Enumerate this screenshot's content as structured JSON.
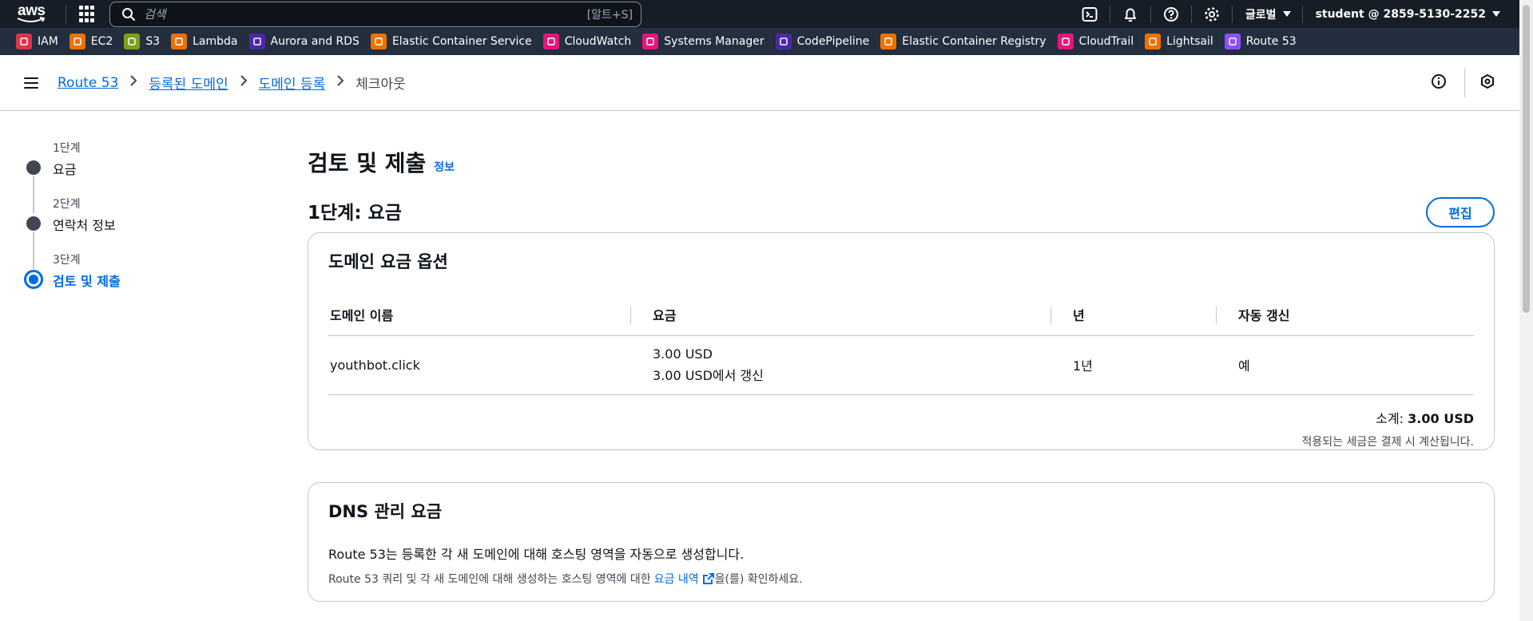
{
  "topnav": {
    "logo_text": "aws",
    "search_placeholder": "검색",
    "search_shortcut": "[알트+S]",
    "region": "글로벌",
    "account": "student @ 2859-5130-2252",
    "icons": [
      "cloudshell-icon",
      "bell-icon",
      "help-icon",
      "settings-icon"
    ]
  },
  "favorites": [
    {
      "label": "IAM",
      "color": "#dd344c",
      "icon": "iam-icon"
    },
    {
      "label": "EC2",
      "color": "#ed7100",
      "icon": "ec2-icon"
    },
    {
      "label": "S3",
      "color": "#7aa116",
      "icon": "s3-icon"
    },
    {
      "label": "Lambda",
      "color": "#ed7100",
      "icon": "lambda-icon"
    },
    {
      "label": "Aurora and RDS",
      "color": "#4d27aa",
      "icon": "rds-icon"
    },
    {
      "label": "Elastic Container Service",
      "color": "#ed7100",
      "icon": "ecs-icon"
    },
    {
      "label": "CloudWatch",
      "color": "#e7157b",
      "icon": "cloudwatch-icon"
    },
    {
      "label": "Systems Manager",
      "color": "#e7157b",
      "icon": "ssm-icon"
    },
    {
      "label": "CodePipeline",
      "color": "#4d27aa",
      "icon": "codepipeline-icon"
    },
    {
      "label": "Elastic Container Registry",
      "color": "#ed7100",
      "icon": "ecr-icon"
    },
    {
      "label": "CloudTrail",
      "color": "#e7157b",
      "icon": "cloudtrail-icon"
    },
    {
      "label": "Lightsail",
      "color": "#ed7100",
      "icon": "lightsail-icon"
    },
    {
      "label": "Route 53",
      "color": "#8c4fff",
      "icon": "route53-icon"
    }
  ],
  "breadcrumb": [
    {
      "label": "Route 53",
      "link": true
    },
    {
      "label": "등록된 도메인",
      "link": true
    },
    {
      "label": "도메인 등록",
      "link": true
    },
    {
      "label": "체크아웃",
      "link": false
    }
  ],
  "steps": [
    {
      "num": "1단계",
      "label": "요금",
      "active": false
    },
    {
      "num": "2단계",
      "label": "연락처 정보",
      "active": false
    },
    {
      "num": "3단계",
      "label": "검토 및 제출",
      "active": true
    }
  ],
  "main": {
    "title": "검토 및 제출",
    "info": "정보",
    "section1_title": "1단계: 요금",
    "edit_label": "편집",
    "card1": {
      "title": "도메인 요금 옵션",
      "columns": [
        "도메인 이름",
        "요금",
        "년",
        "자동 갱신"
      ],
      "row": {
        "domain": "youthbot.click",
        "price": "3.00 USD",
        "renew_price": "3.00 USD에서 갱신",
        "years": "1년",
        "auto_renew": "예"
      },
      "subtotal_label": "소계:",
      "subtotal_value": "3.00 USD",
      "tax_note": "적용되는 세금은 결제 시 계산됩니다."
    },
    "card2": {
      "title": "DNS 관리 요금",
      "desc": "Route 53는 등록한 각 새 도메인에 대해 호스팅 영역을 자동으로 생성합니다.",
      "note_before": "Route 53 쿼리 및 각 새 도메인에 대해 생성하는 호스팅 영역에 대한",
      "note_link": "요금 내역",
      "note_after": "을(를) 확인하세요."
    }
  }
}
